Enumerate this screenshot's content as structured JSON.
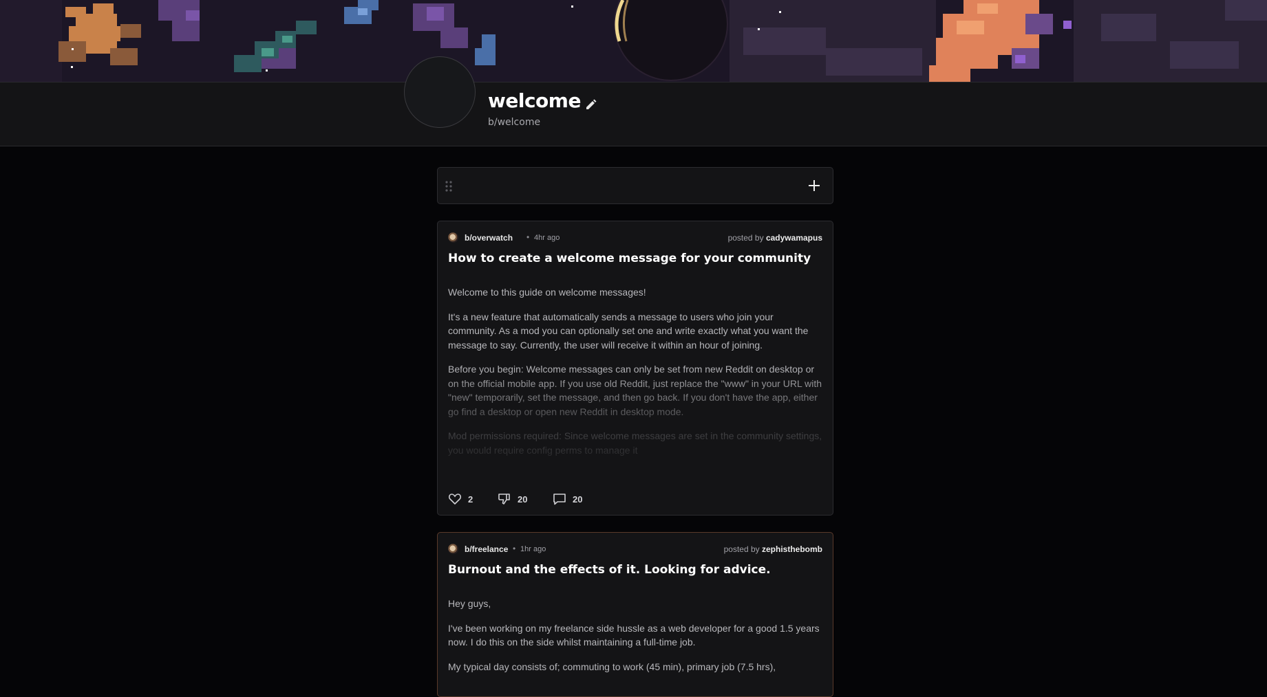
{
  "community": {
    "title": "welcome",
    "handle": "b/welcome"
  },
  "icons": {
    "edit": "pencil-icon",
    "add": "plus-icon",
    "drag": "drag-handle-icon",
    "like": "heart-icon",
    "dislike": "thumbs-down-icon",
    "comment": "comment-icon"
  },
  "posts": [
    {
      "subreddit": "b/overwatch",
      "time": "4hr ago",
      "posted_by_label": "posted by",
      "author": "cadywamapus",
      "title": "How to create a welcome message for your community",
      "paragraphs": [
        "Welcome to this guide on welcome messages!",
        "It's a new feature that automatically sends a message to users who join your community. As a mod you can optionally set one and write exactly what you want the message to say. Currently, the user will receive it within an hour of joining.",
        "Before you begin: Welcome messages can only be set from new Reddit on desktop or on the official mobile app. If you use old Reddit, just replace the \"www\" in your URL with \"new\" temporarily, set the message, and then go back. If you don't have the app, either go find a desktop or open new Reddit in desktop mode.",
        "Mod permissions required: Since welcome messages are set in the community settings, you would require config perms to manage it"
      ],
      "likes": "2",
      "dislikes": "20",
      "comments": "20"
    },
    {
      "subreddit": "b/freelance",
      "time": "1hr ago",
      "posted_by_label": "posted by",
      "author": "zephisthebomb",
      "title": "Burnout and the effects of it. Looking for advice.",
      "paragraphs": [
        "Hey guys,",
        "I've been working on my freelance side hussle as a web developer for a good 1.5 years now. I do this on the side whilst maintaining a full-time job.",
        "My typical day consists of; commuting to work (45 min), primary job (7.5 hrs),"
      ]
    }
  ],
  "colors": {
    "background": "#050507",
    "card": "#141416",
    "border": "#2c2c30",
    "highlight_border": "#5a3a2a"
  }
}
